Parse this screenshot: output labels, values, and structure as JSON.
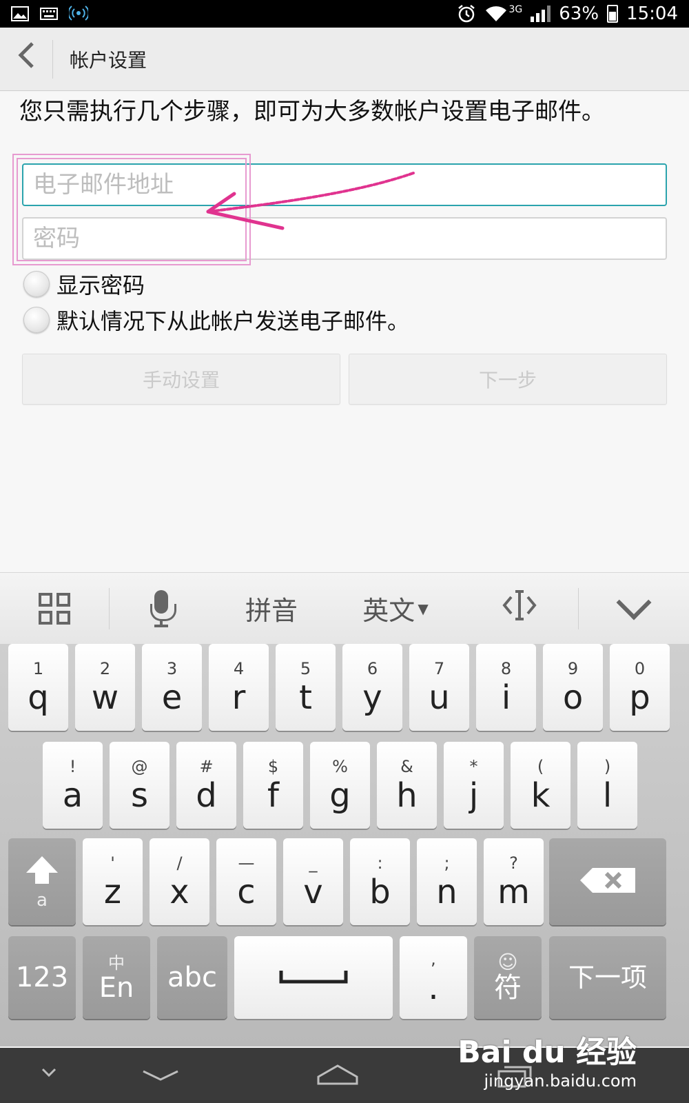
{
  "status_bar": {
    "battery": "63%",
    "time": "15:04",
    "network": "3G",
    "icons": [
      "image-icon",
      "keyboard-icon",
      "hotspot-icon",
      "alarm-icon",
      "wifi-icon",
      "signal-icon",
      "battery-icon"
    ]
  },
  "app_bar": {
    "title": "帐户设置",
    "back_icon": "back-icon"
  },
  "form": {
    "intro": "您只需执行几个步骤，即可为大多数帐户设置电子邮件。",
    "email_placeholder": "电子邮件地址",
    "email_value": "",
    "password_placeholder": "密码",
    "password_value": "",
    "show_password_label": "显示密码",
    "default_send_label": "默认情况下从此帐户发送电子邮件。",
    "manual_setup_label": "手动设置",
    "next_label": "下一步"
  },
  "annotation": {
    "color": "#e0338f"
  },
  "keyboard_toolbar": {
    "pinyin": "拼音",
    "english": "英文",
    "icons": [
      "grid-icon",
      "mic-icon",
      "cursor-move-icon",
      "collapse-keyboard-icon"
    ]
  },
  "keyboard": {
    "row1": [
      {
        "sub": "1",
        "main": "q"
      },
      {
        "sub": "2",
        "main": "w"
      },
      {
        "sub": "3",
        "main": "e"
      },
      {
        "sub": "4",
        "main": "r"
      },
      {
        "sub": "5",
        "main": "t"
      },
      {
        "sub": "6",
        "main": "y"
      },
      {
        "sub": "7",
        "main": "u"
      },
      {
        "sub": "8",
        "main": "i"
      },
      {
        "sub": "9",
        "main": "o"
      },
      {
        "sub": "0",
        "main": "p"
      }
    ],
    "row2": [
      {
        "sub": "!",
        "main": "a"
      },
      {
        "sub": "@",
        "main": "s"
      },
      {
        "sub": "#",
        "main": "d"
      },
      {
        "sub": "$",
        "main": "f"
      },
      {
        "sub": "%",
        "main": "g"
      },
      {
        "sub": "&",
        "main": "h"
      },
      {
        "sub": "*",
        "main": "j"
      },
      {
        "sub": "(",
        "main": "k"
      },
      {
        "sub": ")",
        "main": "l"
      }
    ],
    "row3": [
      {
        "sub": "'",
        "main": "z"
      },
      {
        "sub": "/",
        "main": "x"
      },
      {
        "sub": "—",
        "main": "c"
      },
      {
        "sub": "_",
        "main": "v"
      },
      {
        "sub": ":",
        "main": "b"
      },
      {
        "sub": ";",
        "main": "n"
      },
      {
        "sub": "?",
        "main": "m"
      }
    ],
    "shift_sub": "a",
    "num_label": "123",
    "lang_sub": "中",
    "lang_main": "En",
    "abc_label": "abc",
    "space_label": "⎵",
    "punct_sub": ",",
    "punct_main": ".",
    "symbol_label": "符",
    "symbol_sub": "☺",
    "next_item_label": "下一项",
    "backspace_icon": "backspace-icon",
    "shift_icon": "shift-icon"
  },
  "watermark": {
    "logo": "Bai du 经验",
    "url": "jingyan.baidu.com"
  }
}
